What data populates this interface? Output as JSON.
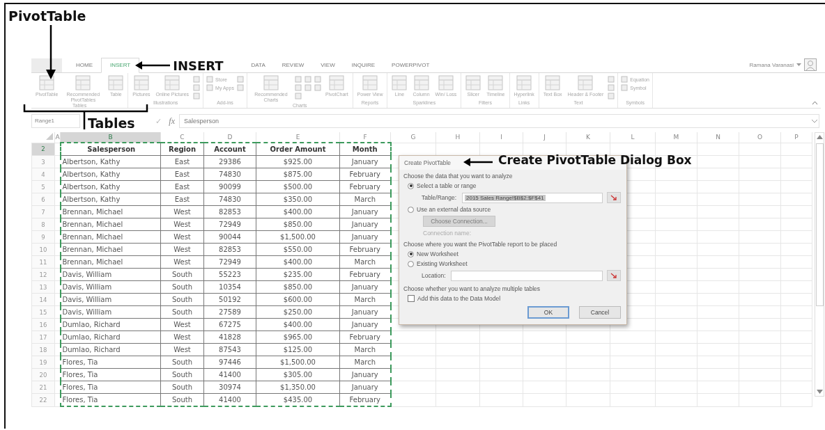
{
  "annotations": {
    "pivottable": "PivotTable",
    "insert": "INSERT",
    "tables": "Tables",
    "dialog": "Create PivotTable Dialog Box"
  },
  "ribbon": {
    "tabs": [
      {
        "label": "HOME",
        "selected": false
      },
      {
        "label": "INSERT",
        "selected": true
      },
      {
        "label": "DATA",
        "selected": false
      },
      {
        "label": "REVIEW",
        "selected": false
      },
      {
        "label": "VIEW",
        "selected": false
      },
      {
        "label": "INQUIRE",
        "selected": false
      },
      {
        "label": "POWERPIVOT",
        "selected": false
      }
    ],
    "user": "Ramana Varanasi",
    "groups": [
      {
        "name": "Tables",
        "items": [
          {
            "kind": "large",
            "label": "PivotTable"
          },
          {
            "kind": "large",
            "label": "Recommended PivotTables"
          },
          {
            "kind": "large",
            "label": "Table"
          }
        ]
      },
      {
        "name": "Illustrations",
        "items": [
          {
            "kind": "large",
            "label": "Pictures"
          },
          {
            "kind": "large",
            "label": "Online Pictures"
          },
          {
            "kind": "stack",
            "entries": [
              {
                "kind": "icon"
              },
              {
                "kind": "icon"
              },
              {
                "kind": "icon"
              }
            ]
          }
        ]
      },
      {
        "name": "Add-ins",
        "items": [
          {
            "kind": "stack",
            "entries": [
              {
                "kind": "labeled",
                "label": "Store"
              },
              {
                "kind": "labeled",
                "label": "My Apps"
              }
            ]
          },
          {
            "kind": "stack",
            "entries": [
              {
                "kind": "icon"
              },
              {
                "kind": "icon"
              }
            ]
          }
        ]
      },
      {
        "name": "Charts",
        "items": [
          {
            "kind": "large",
            "label": "Recommended Charts"
          },
          {
            "kind": "stack",
            "entries": [
              {
                "kind": "icon"
              },
              {
                "kind": "icon"
              },
              {
                "kind": "icon"
              }
            ]
          },
          {
            "kind": "stack",
            "entries": [
              {
                "kind": "icon"
              },
              {
                "kind": "icon"
              }
            ]
          },
          {
            "kind": "stack",
            "entries": [
              {
                "kind": "icon"
              },
              {
                "kind": "icon"
              }
            ]
          },
          {
            "kind": "large",
            "label": "PivotChart"
          }
        ]
      },
      {
        "name": "Reports",
        "items": [
          {
            "kind": "large",
            "label": "Power View"
          }
        ]
      },
      {
        "name": "Sparklines",
        "items": [
          {
            "kind": "large",
            "label": "Line"
          },
          {
            "kind": "large",
            "label": "Column"
          },
          {
            "kind": "large",
            "label": "Win/ Loss"
          }
        ]
      },
      {
        "name": "Filters",
        "items": [
          {
            "kind": "large",
            "label": "Slicer"
          },
          {
            "kind": "large",
            "label": "Timeline"
          }
        ]
      },
      {
        "name": "Links",
        "items": [
          {
            "kind": "large",
            "label": "Hyperlink"
          }
        ]
      },
      {
        "name": "Text",
        "items": [
          {
            "kind": "large",
            "label": "Text Box"
          },
          {
            "kind": "large",
            "label": "Header & Footer"
          },
          {
            "kind": "stack",
            "entries": [
              {
                "kind": "icon"
              },
              {
                "kind": "icon"
              },
              {
                "kind": "icon"
              }
            ]
          }
        ]
      },
      {
        "name": "Symbols",
        "items": [
          {
            "kind": "stack",
            "entries": [
              {
                "kind": "labeled",
                "label": "Equation"
              },
              {
                "kind": "labeled",
                "label": "Symbol"
              }
            ]
          }
        ]
      }
    ]
  },
  "formula_bar": {
    "name_box": "Range1",
    "check": "✓",
    "fx": "fx",
    "value": "Salesperson"
  },
  "sheet": {
    "columns": [
      {
        "label": "A",
        "selected": false
      },
      {
        "label": "B",
        "selected": true
      },
      {
        "label": "C",
        "selected": false
      },
      {
        "label": "D",
        "selected": false
      },
      {
        "label": "E",
        "selected": false
      },
      {
        "label": "F",
        "selected": false
      },
      {
        "label": "G",
        "selected": false
      },
      {
        "label": "H",
        "selected": false
      },
      {
        "label": "I",
        "selected": false
      },
      {
        "label": "J",
        "selected": false
      },
      {
        "label": "K",
        "selected": false
      },
      {
        "label": "L",
        "selected": false
      },
      {
        "label": "M",
        "selected": false
      },
      {
        "label": "N",
        "selected": false
      },
      {
        "label": "O",
        "selected": false
      },
      {
        "label": "P",
        "selected": false
      }
    ],
    "rows": [
      {
        "number": "2",
        "selected": true,
        "kind": "header",
        "cells": [
          "",
          "Salesperson",
          "Region",
          "Account",
          "Order Amount",
          "Month"
        ]
      },
      {
        "number": "3",
        "selected": false,
        "kind": "data",
        "cells": [
          "",
          "Albertson, Kathy",
          "East",
          "29386",
          "$925.00",
          "January"
        ]
      },
      {
        "number": "4",
        "selected": false,
        "kind": "data",
        "cells": [
          "",
          "Albertson, Kathy",
          "East",
          "74830",
          "$875.00",
          "February"
        ]
      },
      {
        "number": "5",
        "selected": false,
        "kind": "data",
        "cells": [
          "",
          "Albertson, Kathy",
          "East",
          "90099",
          "$500.00",
          "February"
        ]
      },
      {
        "number": "6",
        "selected": false,
        "kind": "data",
        "cells": [
          "",
          "Albertson, Kathy",
          "East",
          "74830",
          "$350.00",
          "March"
        ]
      },
      {
        "number": "7",
        "selected": false,
        "kind": "data",
        "cells": [
          "",
          "Brennan, Michael",
          "West",
          "82853",
          "$400.00",
          "January"
        ]
      },
      {
        "number": "8",
        "selected": false,
        "kind": "data",
        "cells": [
          "",
          "Brennan, Michael",
          "West",
          "72949",
          "$850.00",
          "January"
        ]
      },
      {
        "number": "9",
        "selected": false,
        "kind": "data",
        "cells": [
          "",
          "Brennan, Michael",
          "West",
          "90044",
          "$1,500.00",
          "January"
        ]
      },
      {
        "number": "10",
        "selected": false,
        "kind": "data",
        "cells": [
          "",
          "Brennan, Michael",
          "West",
          "82853",
          "$550.00",
          "February"
        ]
      },
      {
        "number": "11",
        "selected": false,
        "kind": "data",
        "cells": [
          "",
          "Brennan, Michael",
          "West",
          "72949",
          "$400.00",
          "March"
        ]
      },
      {
        "number": "12",
        "selected": false,
        "kind": "data",
        "cells": [
          "",
          "Davis, William",
          "South",
          "55223",
          "$235.00",
          "February"
        ]
      },
      {
        "number": "13",
        "selected": false,
        "kind": "data",
        "cells": [
          "",
          "Davis, William",
          "South",
          "10354",
          "$850.00",
          "January"
        ]
      },
      {
        "number": "14",
        "selected": false,
        "kind": "data",
        "cells": [
          "",
          "Davis, William",
          "South",
          "50192",
          "$600.00",
          "March"
        ]
      },
      {
        "number": "15",
        "selected": false,
        "kind": "data",
        "cells": [
          "",
          "Davis, William",
          "South",
          "27589",
          "$250.00",
          "January"
        ]
      },
      {
        "number": "16",
        "selected": false,
        "kind": "data",
        "cells": [
          "",
          "Dumlao, Richard",
          "West",
          "67275",
          "$400.00",
          "January"
        ]
      },
      {
        "number": "17",
        "selected": false,
        "kind": "data",
        "cells": [
          "",
          "Dumlao, Richard",
          "West",
          "41828",
          "$965.00",
          "February"
        ]
      },
      {
        "number": "18",
        "selected": false,
        "kind": "data",
        "cells": [
          "",
          "Dumlao, Richard",
          "West",
          "87543",
          "$125.00",
          "March"
        ]
      },
      {
        "number": "19",
        "selected": false,
        "kind": "data",
        "cells": [
          "",
          "Flores, Tia",
          "South",
          "97446",
          "$1,500.00",
          "March"
        ]
      },
      {
        "number": "20",
        "selected": false,
        "kind": "data",
        "cells": [
          "",
          "Flores, Tia",
          "South",
          "41400",
          "$305.00",
          "January"
        ]
      },
      {
        "number": "21",
        "selected": false,
        "kind": "data",
        "cells": [
          "",
          "Flores, Tia",
          "South",
          "30974",
          "$1,350.00",
          "January"
        ]
      },
      {
        "number": "22",
        "selected": false,
        "kind": "data",
        "cells": [
          "",
          "Flores, Tia",
          "South",
          "41400",
          "$435.00",
          "February"
        ]
      }
    ]
  },
  "dialog": {
    "title": "Create PivotTable",
    "section_1": "Choose the data that you want to analyze",
    "source_options": [
      {
        "label": "Select a table or range",
        "selected": true
      },
      {
        "label": "Use an external data source",
        "selected": false
      }
    ],
    "range_label": "Table/Range:",
    "range_value": "2015 Sales Range!$B$2:$F$41",
    "connection_button": {
      "label": "Choose Connection...",
      "disabled": true
    },
    "connection_label": "Connection name:",
    "section_2": "Choose where you want the PivotTable report to be placed",
    "placement_options": [
      {
        "label": "New Worksheet",
        "selected": true
      },
      {
        "label": "Existing Worksheet",
        "selected": false
      }
    ],
    "location_label": "Location:",
    "section_3": "Choose whether you want to analyze multiple tables",
    "data_model": {
      "label": "Add this data to the Data Model",
      "checked": false
    },
    "buttons": [
      {
        "label": "OK",
        "default": true
      },
      {
        "label": "Cancel",
        "default": false
      }
    ]
  }
}
